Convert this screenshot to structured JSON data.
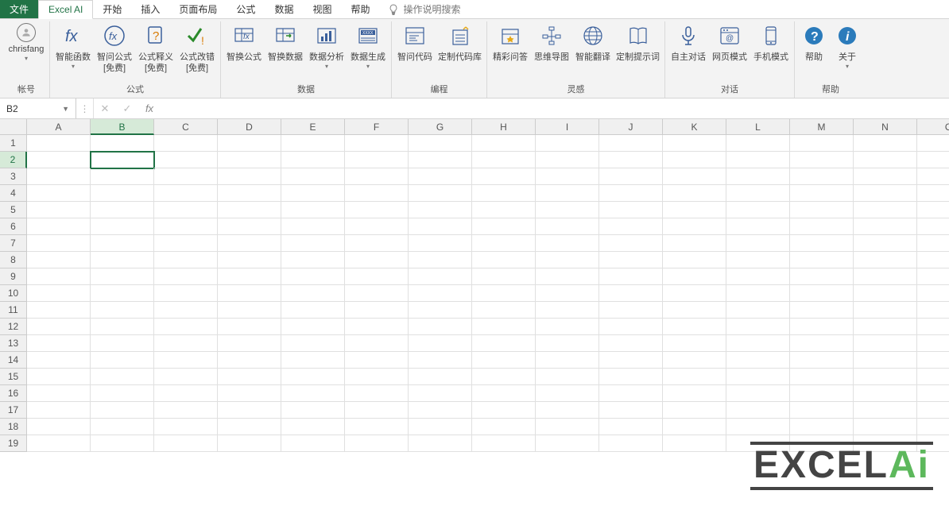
{
  "tabs": {
    "file": "文件",
    "excel_ai": "Excel AI",
    "home": "开始",
    "insert": "插入",
    "layout": "页面布局",
    "formula": "公式",
    "data": "数据",
    "view": "视图",
    "help": "帮助",
    "tell": "操作说明搜索"
  },
  "ribbon": {
    "account": {
      "user": "chrisfang",
      "label": "帐号"
    },
    "formula_group": {
      "smart_fn": "智能函数",
      "ask_formula": "智问公式",
      "ask_formula_sub": "[免费]",
      "formula_explain": "公式释义",
      "formula_explain_sub": "[免费]",
      "formula_fix": "公式改错",
      "formula_fix_sub": "[免费]",
      "group_label": "公式"
    },
    "data_group": {
      "swap_formula": "智换公式",
      "swap_data": "智换数据",
      "data_analysis": "数据分析",
      "data_gen": "数据生成",
      "group_label": "数据"
    },
    "code_group": {
      "ask_code": "智问代码",
      "custom_lib": "定制代码库",
      "group_label": "编程"
    },
    "inspire_group": {
      "qa": "精彩问答",
      "mindmap": "思维导图",
      "translate": "智能翻译",
      "custom_prompt": "定制提示词",
      "group_label": "灵感"
    },
    "dialog_group": {
      "auto_dialog": "自主对话",
      "web_mode": "网页模式",
      "mobile_mode": "手机模式",
      "group_label": "对话"
    },
    "help_group": {
      "help": "帮助",
      "about": "关于",
      "group_label": "帮助"
    }
  },
  "formula_bar": {
    "name_box": "B2",
    "value": ""
  },
  "grid": {
    "columns": [
      "A",
      "B",
      "C",
      "D",
      "E",
      "F",
      "G",
      "H",
      "I",
      "J",
      "K",
      "L",
      "M",
      "N",
      "O"
    ],
    "rows": 19,
    "selected_col": 1,
    "selected_row": 1
  },
  "watermark": {
    "text_main": "EXCEL",
    "text_accent": "Ai"
  },
  "colors": {
    "brand": "#217346",
    "accent": "#5db85c"
  }
}
